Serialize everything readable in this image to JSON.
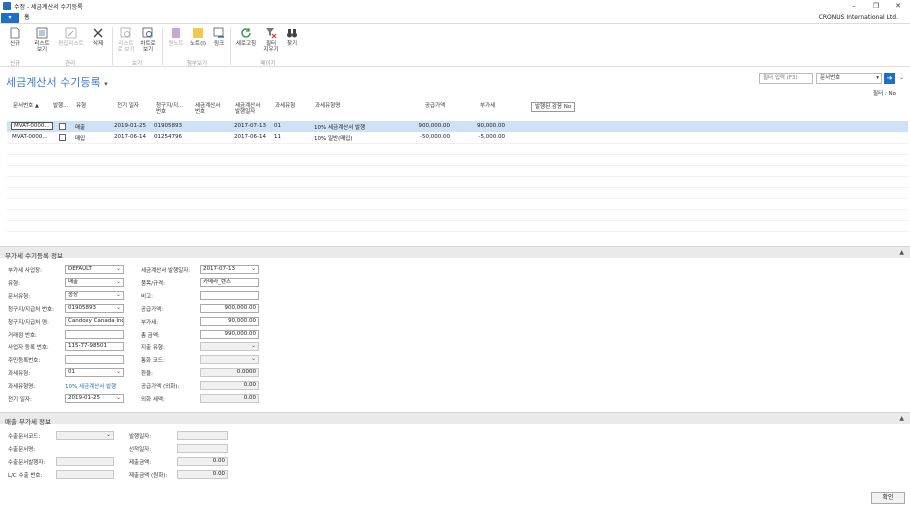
{
  "window": {
    "title": "수정 - 세금계산서 수기등록",
    "company": "CRONUS International Ltd."
  },
  "ribbon": {
    "file_tab": "▾",
    "home_tab": "홈",
    "buttons": {
      "new": "신규",
      "list_view": "리스트\n보기",
      "edit_list": "편집리스트",
      "delete": "삭제",
      "list_view2": "리스트\n로 보기",
      "chart_view": "차트로\n보기",
      "onenote": "원노트",
      "notes": "노트(I)",
      "links": "링크",
      "refresh": "새로고침",
      "clear_filter": "필터\n지우기",
      "find": "찾기"
    },
    "groups": {
      "new": "신규",
      "manage": "관리",
      "view": "보기",
      "attach": "첨부보기",
      "page": "페이지"
    }
  },
  "page": {
    "title": "세금계산서 수기등록",
    "filter_placeholder": "필터 입력 (F3)",
    "filter_field": "문서번호",
    "sort_info": "필터 : No"
  },
  "table": {
    "headers": [
      "문서번호",
      "발행...",
      "유형",
      "전기 일자",
      "청구지/지...\n번호",
      "세금계산서\n번호",
      "세금계산서\n발행일자",
      "과세유형",
      "과세유형명",
      "공급가액",
      "부가세",
      "발행된 감응 No"
    ],
    "rows": [
      {
        "doc": "MVAT-0000...",
        "type": "매출",
        "post": "2019-01-25",
        "bill": "01905893",
        "taxno": "",
        "issue": "2017-07-13",
        "vtype": "01",
        "vname": "10% 세금계산서 발행",
        "supply": "900,000.00",
        "vat": "90,000.00"
      },
      {
        "doc": "MVAT-0000...",
        "type": "매입",
        "post": "2017-06-14",
        "bill": "01254796",
        "taxno": "",
        "issue": "2017-06-14",
        "vtype": "11",
        "vname": "10% 일반(매입)",
        "supply": "-50,000.00",
        "vat": "-5,000.00"
      }
    ]
  },
  "vat_section": {
    "title": "부가세 수기등록 정보",
    "left": [
      {
        "label": "부가세 사업장:",
        "value": "DEFAULT",
        "kind": "sel"
      },
      {
        "label": "유형:",
        "value": "매출",
        "kind": "sel"
      },
      {
        "label": "문서유형:",
        "value": "송장",
        "kind": "sel"
      },
      {
        "label": "청구지/지급처 번호:",
        "value": "01905893",
        "kind": "sel"
      },
      {
        "label": "청구지/지급처 명:",
        "value": "Candoxy Canada Inc.",
        "kind": "txt"
      },
      {
        "label": "거래점 번호:",
        "value": "",
        "kind": "txt"
      },
      {
        "label": "사업자 등록 번호:",
        "value": "115-77-98501",
        "kind": "txt"
      },
      {
        "label": "주민등록번호:",
        "value": "",
        "kind": "txt"
      },
      {
        "label": "과세유형:",
        "value": "01",
        "kind": "sel"
      },
      {
        "label": "과세유형명:",
        "value": "10% 세금계산서 발행",
        "kind": "link"
      },
      {
        "label": "전기 일자:",
        "value": "2019-01-25",
        "kind": "sel"
      }
    ],
    "right": [
      {
        "label": "세금계산서 발행일자:",
        "value": "2017-07-13",
        "kind": "sel"
      },
      {
        "label": "품목/규격:",
        "value": "카메라_렌즈",
        "kind": "txt"
      },
      {
        "label": "비고:",
        "value": "",
        "kind": "txt"
      },
      {
        "label": "공급가액:",
        "value": "900,000.00",
        "kind": "num"
      },
      {
        "label": "부가세:",
        "value": "90,000.00",
        "kind": "num"
      },
      {
        "label": "총 금액:",
        "value": "990,000.00",
        "kind": "num"
      },
      {
        "label": "지출 유형:",
        "value": "",
        "kind": "rosel"
      },
      {
        "label": "통화 코드:",
        "value": "",
        "kind": "rosel"
      },
      {
        "label": "환율:",
        "value": "0.0000",
        "kind": "ronum"
      },
      {
        "label": "공급가액 (외화):",
        "value": "0.00",
        "kind": "ronum"
      },
      {
        "label": "외화 세액:",
        "value": "0.00",
        "kind": "ronum"
      }
    ]
  },
  "export_section": {
    "title": "매출 부가세 정보",
    "left": [
      {
        "label": "수출문서코드:",
        "value": "",
        "kind": "rosel"
      },
      {
        "label": "수출문서명:",
        "value": "",
        "kind": "none"
      },
      {
        "label": "수출문서발행자:",
        "value": "",
        "kind": "ro"
      },
      {
        "label": "L/C 수출 번호:",
        "value": "",
        "kind": "ro"
      }
    ],
    "right": [
      {
        "label": "발행일자:",
        "value": "",
        "kind": "ro"
      },
      {
        "label": "선적일자:",
        "value": "",
        "kind": "ro"
      },
      {
        "label": "제출금액:",
        "value": "0.00",
        "kind": "ronum"
      },
      {
        "label": "제출금액 (원화):",
        "value": "0.00",
        "kind": "ronum"
      }
    ]
  },
  "ok_button": "확인",
  "colors": {
    "accent": "#1e6fc8",
    "title": "#3b7ec8",
    "selected_row": "#cfe2f5"
  }
}
